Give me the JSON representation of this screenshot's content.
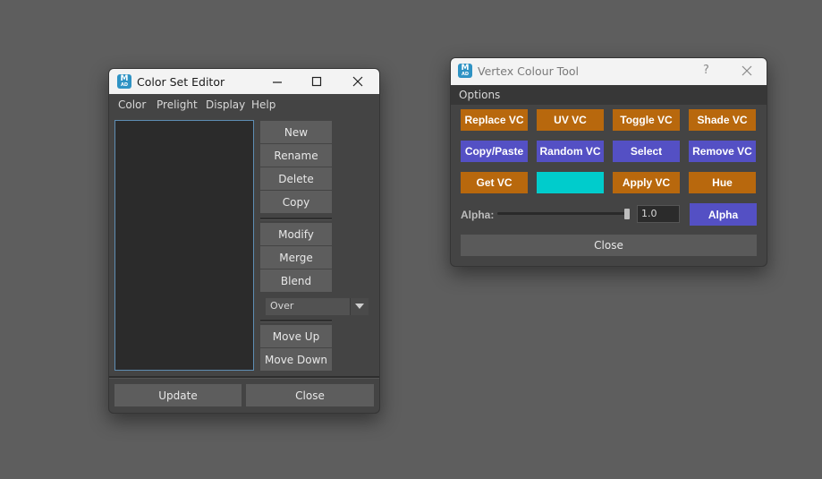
{
  "color_set_editor": {
    "title": "Color Set Editor",
    "menu": [
      "Color",
      "Prelight",
      "Display",
      "Help"
    ],
    "buttons_top": [
      "New",
      "Rename",
      "Delete",
      "Copy"
    ],
    "buttons_mid": [
      "Modify",
      "Merge",
      "Blend"
    ],
    "blend_mode": "Over",
    "buttons_bottom": [
      "Move Up",
      "Move Down"
    ],
    "update_label": "Update",
    "close_label": "Close"
  },
  "vertex_colour_tool": {
    "title": "Vertex Colour Tool",
    "help_glyph": "?",
    "menu_options": "Options",
    "row1": [
      "Replace VC",
      "UV VC",
      "Toggle VC",
      "Shade VC"
    ],
    "row2": [
      "Copy/Paste",
      "Random VC",
      "Select",
      "Remove VC"
    ],
    "row3": [
      "Get VC",
      "",
      "Apply VC",
      "Hue"
    ],
    "alpha_label": "Alpha:",
    "alpha_value": "1.0",
    "alpha_slider_fraction": 1.0,
    "alpha_button": "Alpha",
    "close_label": "Close"
  },
  "colors": {
    "orange": "#b8680d",
    "purple": "#5450c4",
    "swatch": "#00cccc"
  },
  "icons": {
    "app": "maya-icon",
    "minimize": "minimize-icon",
    "maximize": "maximize-icon",
    "close": "close-icon",
    "dropdown": "chevron-down-icon"
  }
}
